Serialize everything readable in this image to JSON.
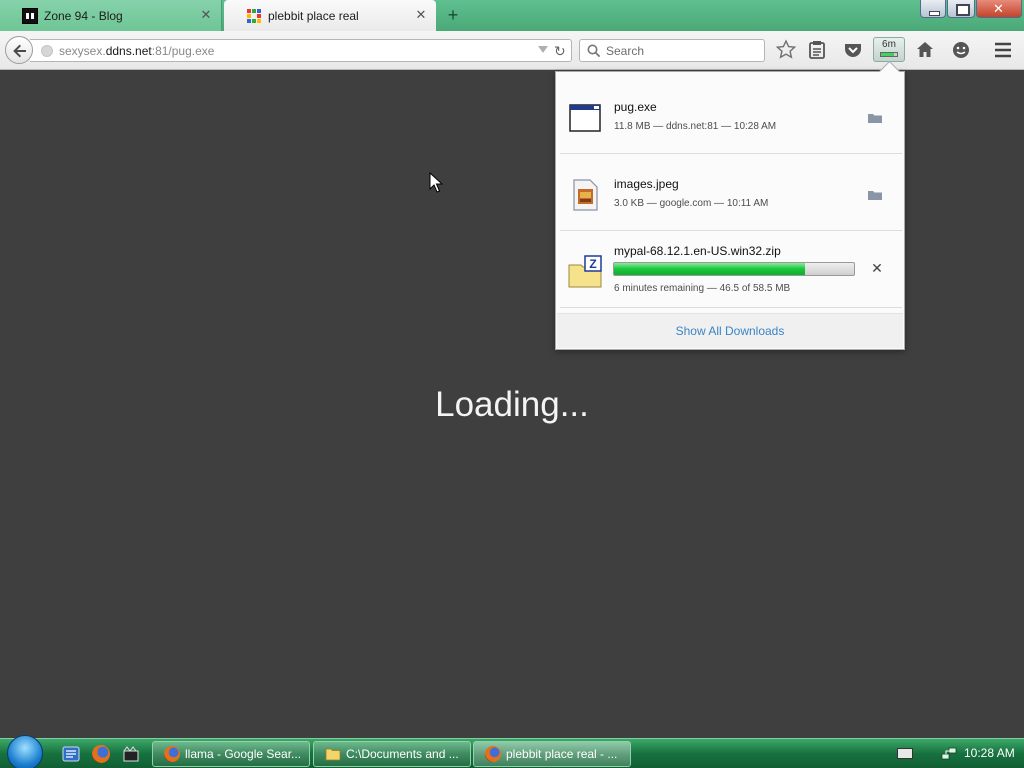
{
  "window": {
    "tabs": [
      {
        "label": "Zone 94 - Blog",
        "favicon": "zone94-favicon",
        "active": false
      },
      {
        "label": "plebbit place real",
        "favicon": "plebbit-place-favicon",
        "active": true
      }
    ],
    "new_tab_label": "+"
  },
  "navbar": {
    "url": {
      "prefix": "sexysex.",
      "host": "ddns.net",
      "suffix": ":81/pug.exe"
    },
    "search_placeholder": "Search",
    "downloads_time": "6m",
    "downloads_progress_fraction": 0.795,
    "icons": [
      "back-icon",
      "history-dropdown-icon",
      "reload-icon",
      "search-icon",
      "bookmark-star-icon",
      "reading-list-icon",
      "pocket-icon",
      "downloads-icon",
      "home-icon",
      "hello-icon",
      "menu-icon"
    ]
  },
  "content": {
    "loading_text": "Loading..."
  },
  "downloads_panel": {
    "items": [
      {
        "name": "pug.exe",
        "status": "11.8 MB — ddns.net:81 — 10:28 AM",
        "icon": "exe-file-icon",
        "action": "open-folder-icon"
      },
      {
        "name": "images.jpeg",
        "status": "3.0 KB — google.com — 10:11 AM",
        "icon": "image-file-icon",
        "action": "open-folder-icon"
      },
      {
        "name": "mypal-68.12.1.en-US.win32.zip",
        "status": "6 minutes remaining — 46.5 of 58.5 MB",
        "icon": "zip-file-icon",
        "action": "cancel-icon",
        "progress_fraction": 0.795
      }
    ],
    "show_all_label": "Show All Downloads"
  },
  "taskbar": {
    "tasks": [
      {
        "label": "llama - Google Sear...",
        "icon": "firefox-icon"
      },
      {
        "label": "C:\\Documents and ...",
        "icon": "folder-icon"
      },
      {
        "label": "plebbit place real - ...",
        "icon": "firefox-icon",
        "active": true
      }
    ],
    "clock": "10:28 AM"
  },
  "colors": {
    "titlebar": "#4ba978",
    "content_bg": "#3f3f3f",
    "progress_fill": "#18c63c",
    "link": "#3a85c4",
    "taskbar": "#17723f"
  }
}
